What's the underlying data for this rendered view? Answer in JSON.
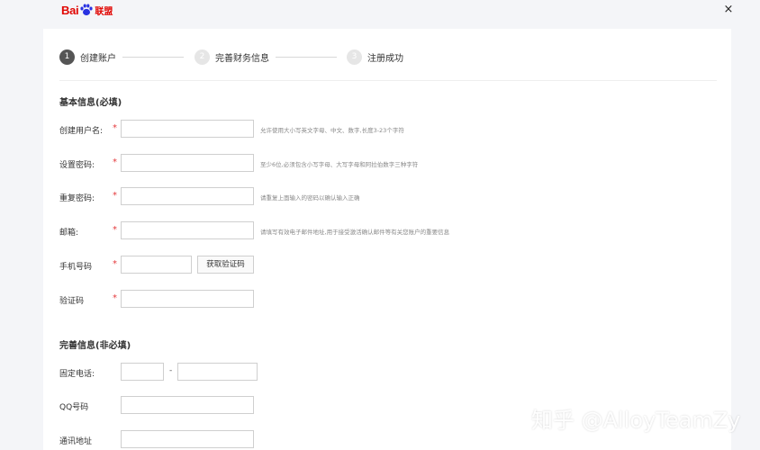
{
  "header": {
    "logo_text": "Bai",
    "logo_suffix": "联盟",
    "close_glyph": "×"
  },
  "steps": [
    {
      "num": "1",
      "label": "创建账户",
      "state": "active"
    },
    {
      "num": "2",
      "label": "完善财务信息",
      "state": "idle"
    },
    {
      "num": "3",
      "label": "注册成功",
      "state": "idle"
    }
  ],
  "basic_section": {
    "title": "基本信息(必填)",
    "required_mark": "*",
    "fields": [
      {
        "label": "创建用户名:",
        "value": "",
        "hint": "允许使用大小写英文字母、中文、数字,长度3-23个字符"
      },
      {
        "label": "设置密码:",
        "value": "",
        "hint": "至少6位,必须包含小写字母、大写字母和阿拉伯数字三种字符"
      },
      {
        "label": "重复密码:",
        "value": "",
        "hint": "请重复上面输入的密码以确认输入正确"
      },
      {
        "label": "邮箱:",
        "value": "",
        "hint": "请填写有效电子邮件地址,用于接受激活确认邮件等有关您账户的重要信息"
      },
      {
        "label": "手机号码",
        "value": ""
      },
      {
        "label": "验证码",
        "value": ""
      }
    ],
    "get_code_button": "获取验证码"
  },
  "optional_section": {
    "title": "完善信息(非必填)",
    "fields": [
      {
        "label": "固定电话:",
        "area_code": "",
        "number": "",
        "separator": "-"
      },
      {
        "label": "QQ号码",
        "value": ""
      },
      {
        "label": "通讯地址",
        "value": ""
      }
    ]
  },
  "watermark": "知乎 @AlloyTeamZy",
  "colors": {
    "brand_red": "#e10602",
    "required_red": "#e4393c",
    "active_step": "#555555",
    "idle_step": "#e6e6e6"
  }
}
